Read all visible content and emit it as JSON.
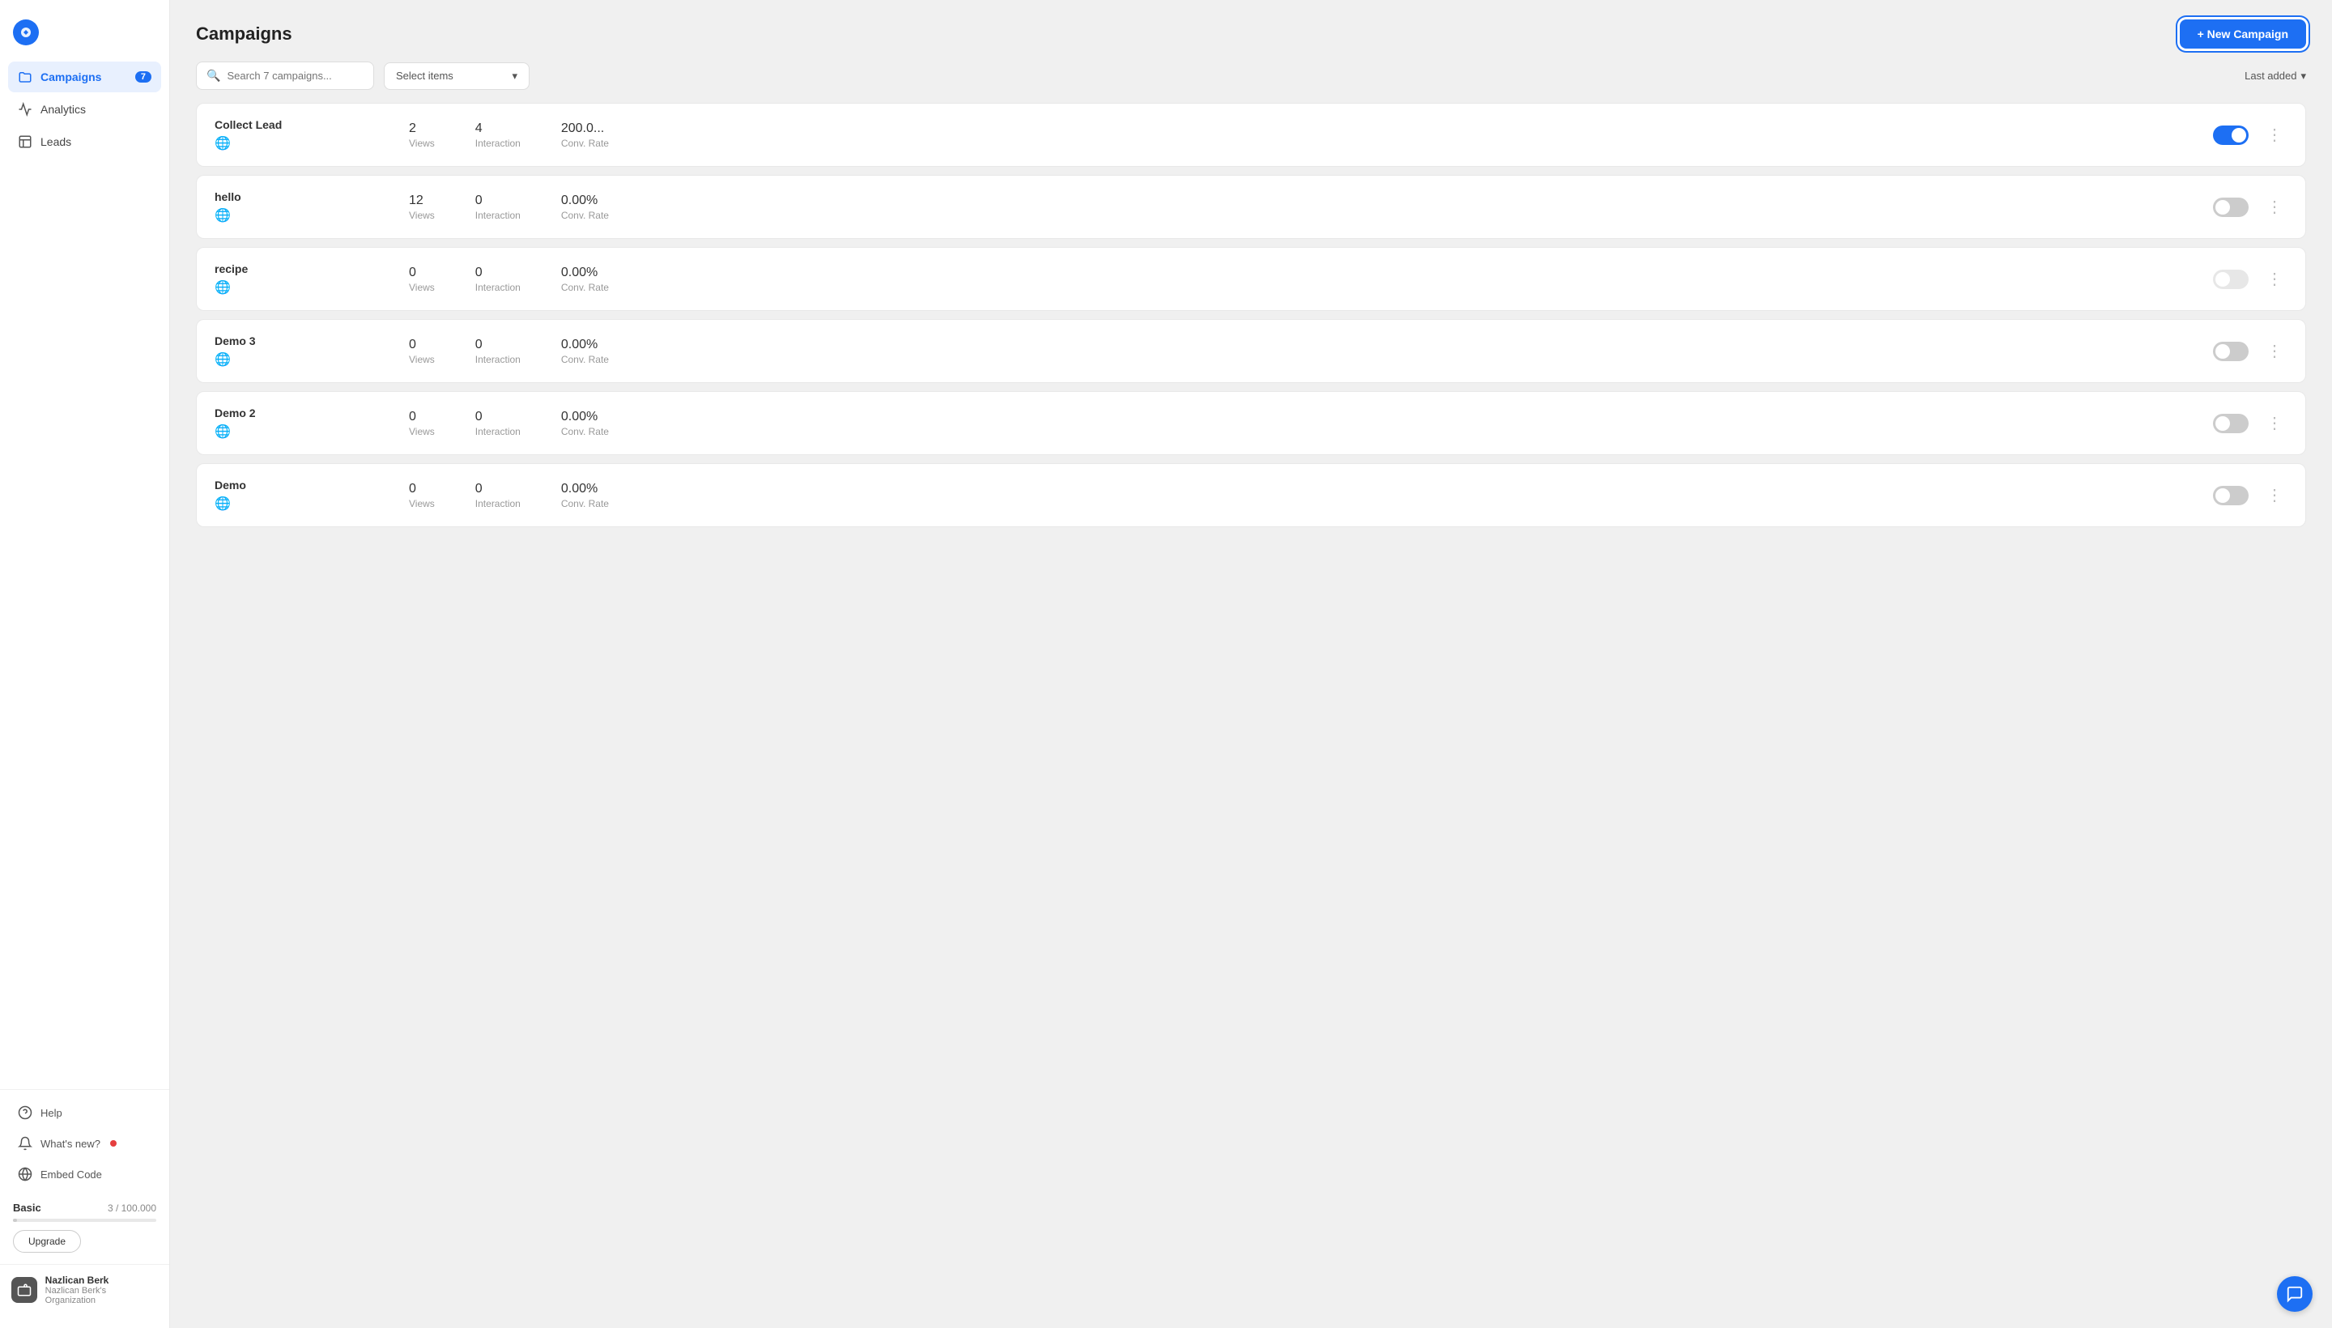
{
  "sidebar": {
    "nav_items": [
      {
        "id": "campaigns",
        "label": "Campaigns",
        "badge": "7",
        "active": true
      },
      {
        "id": "analytics",
        "label": "Analytics",
        "badge": null,
        "active": false
      },
      {
        "id": "leads",
        "label": "Leads",
        "badge": null,
        "active": false
      }
    ],
    "bottom_items": [
      {
        "id": "help",
        "label": "Help"
      },
      {
        "id": "whats-new",
        "label": "What's new?",
        "has_dot": true
      },
      {
        "id": "embed-code",
        "label": "Embed Code"
      }
    ],
    "plan": {
      "label": "Basic",
      "count": "3 / 100.000",
      "upgrade_label": "Upgrade"
    },
    "user": {
      "name": "Nazlican Berk",
      "org": "Nazlican Berk's Organization"
    }
  },
  "header": {
    "title": "Campaigns",
    "new_campaign_label": "+ New Campaign"
  },
  "toolbar": {
    "search_placeholder": "Search 7 campaigns...",
    "select_items_label": "Select items",
    "sort_label": "Last added"
  },
  "campaigns": [
    {
      "name": "Collect Lead",
      "views": "2",
      "interaction": "4",
      "conv_rate": "200.0...",
      "toggle": "on"
    },
    {
      "name": "hello",
      "views": "12",
      "interaction": "0",
      "conv_rate": "0.00%",
      "toggle": "off"
    },
    {
      "name": "recipe",
      "views": "0",
      "interaction": "0",
      "conv_rate": "0.00%",
      "toggle": "disabled"
    },
    {
      "name": "Demo 3",
      "views": "0",
      "interaction": "0",
      "conv_rate": "0.00%",
      "toggle": "off"
    },
    {
      "name": "Demo 2",
      "views": "0",
      "interaction": "0",
      "conv_rate": "0.00%",
      "toggle": "off"
    },
    {
      "name": "Demo",
      "views": "0",
      "interaction": "0",
      "conv_rate": "0.00%",
      "toggle": "off"
    }
  ],
  "labels": {
    "views": "Views",
    "interaction": "Interaction",
    "conv_rate": "Conv. Rate"
  }
}
